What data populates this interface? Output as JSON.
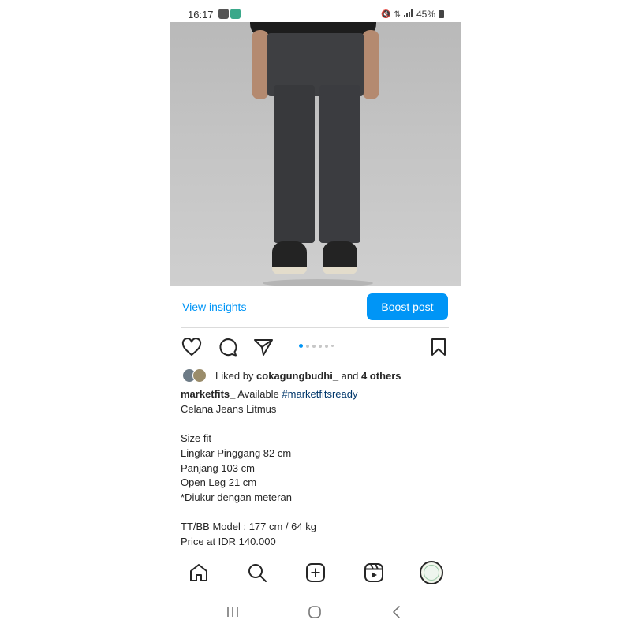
{
  "status_bar": {
    "time": "16:17",
    "battery": "45%",
    "notification_icons": [
      "gallery-icon",
      "app-icon"
    ],
    "system_icons": [
      "mute-icon",
      "volte-icon",
      "signal-icon",
      "battery-icon"
    ]
  },
  "post": {
    "image_description_icon": "product-photo",
    "insights_label": "View insights",
    "boost_label": "Boost post",
    "carousel": {
      "count": 6,
      "active_index": 0
    },
    "likes": {
      "prefix": "Liked by ",
      "user": "cokagungbudhi_",
      "suffix": " and ",
      "others": "4 others"
    },
    "caption": {
      "username": "marketfits_",
      "first_text": " Available ",
      "hashtag": "#marketfitsready",
      "lines": [
        "Celana Jeans Litmus",
        "",
        "Size fit",
        "Lingkar Pinggang 82 cm",
        "Panjang 103 cm",
        "Open Leg 21 cm",
        "*Diukur dengan meteran",
        "",
        "TT/BB Model : 177 cm / 64 kg",
        "Price at IDR 140.000"
      ]
    }
  },
  "bottom_nav": {
    "items": [
      "home-icon",
      "search-icon",
      "create-icon",
      "reels-icon",
      "profile-avatar"
    ]
  },
  "system_nav": {
    "items": [
      "recents-icon",
      "home-button-icon",
      "back-icon"
    ]
  },
  "colors": {
    "accent": "#0095f6",
    "hashtag": "#00376b",
    "text": "#262626"
  }
}
